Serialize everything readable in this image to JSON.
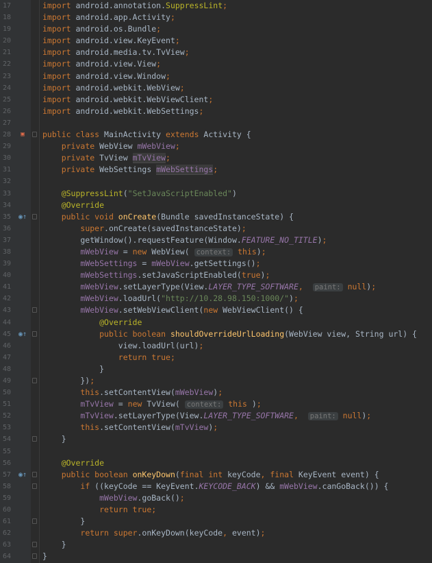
{
  "editor": {
    "lines": [
      {
        "n": "17",
        "t": [
          {
            "c": "k",
            "v": "import "
          },
          {
            "c": "p",
            "v": "android.annotation."
          },
          {
            "c": "a",
            "v": "SuppressLint"
          },
          {
            "c": "k",
            "v": ";"
          }
        ]
      },
      {
        "n": "18",
        "t": [
          {
            "c": "k",
            "v": "import "
          },
          {
            "c": "p",
            "v": "android.app.Activity"
          },
          {
            "c": "k",
            "v": ";"
          }
        ]
      },
      {
        "n": "19",
        "t": [
          {
            "c": "k",
            "v": "import "
          },
          {
            "c": "p",
            "v": "android.os.Bundle"
          },
          {
            "c": "k",
            "v": ";"
          }
        ]
      },
      {
        "n": "20",
        "t": [
          {
            "c": "k",
            "v": "import "
          },
          {
            "c": "p",
            "v": "android.view.KeyEvent"
          },
          {
            "c": "k",
            "v": ";"
          }
        ]
      },
      {
        "n": "21",
        "t": [
          {
            "c": "k",
            "v": "import "
          },
          {
            "c": "p",
            "v": "android.media.tv.TvView"
          },
          {
            "c": "k",
            "v": ";"
          }
        ]
      },
      {
        "n": "22",
        "t": [
          {
            "c": "k",
            "v": "import "
          },
          {
            "c": "p",
            "v": "android.view.View"
          },
          {
            "c": "k",
            "v": ";"
          }
        ]
      },
      {
        "n": "23",
        "t": [
          {
            "c": "k",
            "v": "import "
          },
          {
            "c": "p",
            "v": "android.view.Window"
          },
          {
            "c": "k",
            "v": ";"
          }
        ]
      },
      {
        "n": "24",
        "t": [
          {
            "c": "k",
            "v": "import "
          },
          {
            "c": "p",
            "v": "android.webkit.WebView"
          },
          {
            "c": "k",
            "v": ";"
          }
        ]
      },
      {
        "n": "25",
        "t": [
          {
            "c": "k",
            "v": "import "
          },
          {
            "c": "p",
            "v": "android.webkit.WebViewClient"
          },
          {
            "c": "k",
            "v": ";"
          }
        ]
      },
      {
        "n": "26",
        "t": [
          {
            "c": "k",
            "v": "import "
          },
          {
            "c": "p",
            "v": "android.webkit.WebSettings"
          },
          {
            "c": "k",
            "v": ";"
          }
        ]
      },
      {
        "n": "27",
        "t": []
      },
      {
        "n": "28",
        "icon": "git",
        "t": [
          {
            "c": "k",
            "v": "public class "
          },
          {
            "c": "p",
            "v": "MainActivity "
          },
          {
            "c": "k",
            "v": "extends "
          },
          {
            "c": "p",
            "v": "Activity {"
          }
        ]
      },
      {
        "n": "29",
        "t": [
          {
            "c": "p",
            "v": "    "
          },
          {
            "c": "k",
            "v": "private "
          },
          {
            "c": "p",
            "v": "WebView "
          },
          {
            "c": "f",
            "v": "mWebView"
          },
          {
            "c": "k",
            "v": ";"
          }
        ]
      },
      {
        "n": "30",
        "t": [
          {
            "c": "p",
            "v": "    "
          },
          {
            "c": "k",
            "v": "private "
          },
          {
            "c": "p",
            "v": "TvView "
          },
          {
            "c": "fh",
            "v": "mTvView"
          },
          {
            "c": "k",
            "v": ";"
          }
        ]
      },
      {
        "n": "31",
        "t": [
          {
            "c": "p",
            "v": "    "
          },
          {
            "c": "k",
            "v": "private "
          },
          {
            "c": "p",
            "v": "WebSettings "
          },
          {
            "c": "fh",
            "v": "mWebSettings"
          },
          {
            "c": "k",
            "v": ";"
          }
        ]
      },
      {
        "n": "32",
        "t": []
      },
      {
        "n": "33",
        "t": [
          {
            "c": "p",
            "v": "    "
          },
          {
            "c": "a",
            "v": "@SuppressLint"
          },
          {
            "c": "p",
            "v": "("
          },
          {
            "c": "s",
            "v": "\"SetJavaScriptEnabled\""
          },
          {
            "c": "p",
            "v": ")"
          }
        ]
      },
      {
        "n": "34",
        "t": [
          {
            "c": "p",
            "v": "    "
          },
          {
            "c": "a",
            "v": "@Override"
          }
        ]
      },
      {
        "n": "35",
        "icon": "over",
        "t": [
          {
            "c": "p",
            "v": "    "
          },
          {
            "c": "k",
            "v": "public void "
          },
          {
            "c": "m",
            "v": "onCreate"
          },
          {
            "c": "p",
            "v": "(Bundle savedInstanceState) {"
          }
        ]
      },
      {
        "n": "36",
        "t": [
          {
            "c": "p",
            "v": "        "
          },
          {
            "c": "k",
            "v": "super"
          },
          {
            "c": "p",
            "v": ".onCreate(savedInstanceState)"
          },
          {
            "c": "k",
            "v": ";"
          }
        ]
      },
      {
        "n": "37",
        "t": [
          {
            "c": "p",
            "v": "        getWindow().requestFeature(Window."
          },
          {
            "c": "fi",
            "v": "FEATURE_NO_TITLE"
          },
          {
            "c": "p",
            "v": ")"
          },
          {
            "c": "k",
            "v": ";"
          }
        ]
      },
      {
        "n": "38",
        "t": [
          {
            "c": "p",
            "v": "        "
          },
          {
            "c": "f",
            "v": "mWebView"
          },
          {
            "c": "p",
            "v": " = "
          },
          {
            "c": "k",
            "v": "new "
          },
          {
            "c": "p",
            "v": "WebView( "
          },
          {
            "c": "h",
            "v": "context:"
          },
          {
            "c": "p",
            "v": " "
          },
          {
            "c": "k",
            "v": "this"
          },
          {
            "c": "p",
            "v": ")"
          },
          {
            "c": "k",
            "v": ";"
          }
        ]
      },
      {
        "n": "39",
        "t": [
          {
            "c": "p",
            "v": "        "
          },
          {
            "c": "f",
            "v": "mWebSettings"
          },
          {
            "c": "p",
            "v": " = "
          },
          {
            "c": "f",
            "v": "mWebView"
          },
          {
            "c": "p",
            "v": ".getSettings()"
          },
          {
            "c": "k",
            "v": ";"
          }
        ]
      },
      {
        "n": "40",
        "t": [
          {
            "c": "p",
            "v": "        "
          },
          {
            "c": "f",
            "v": "mWebSettings"
          },
          {
            "c": "p",
            "v": ".setJavaScriptEnabled("
          },
          {
            "c": "k",
            "v": "true"
          },
          {
            "c": "p",
            "v": ")"
          },
          {
            "c": "k",
            "v": ";"
          }
        ]
      },
      {
        "n": "41",
        "t": [
          {
            "c": "p",
            "v": "        "
          },
          {
            "c": "f",
            "v": "mWebView"
          },
          {
            "c": "p",
            "v": ".setLayerType(View."
          },
          {
            "c": "fi",
            "v": "LAYER_TYPE_SOFTWARE"
          },
          {
            "c": "k",
            "v": ","
          },
          {
            "c": "p",
            "v": "  "
          },
          {
            "c": "h",
            "v": "paint:"
          },
          {
            "c": "p",
            "v": " "
          },
          {
            "c": "k",
            "v": "null"
          },
          {
            "c": "p",
            "v": ")"
          },
          {
            "c": "k",
            "v": ";"
          }
        ]
      },
      {
        "n": "42",
        "t": [
          {
            "c": "p",
            "v": "        "
          },
          {
            "c": "f",
            "v": "mWebView"
          },
          {
            "c": "p",
            "v": ".loadUrl("
          },
          {
            "c": "s",
            "v": "\"http://10.28.98.150:1000/\""
          },
          {
            "c": "p",
            "v": ")"
          },
          {
            "c": "k",
            "v": ";"
          }
        ]
      },
      {
        "n": "43",
        "t": [
          {
            "c": "p",
            "v": "        "
          },
          {
            "c": "f",
            "v": "mWebView"
          },
          {
            "c": "p",
            "v": ".setWebViewClient("
          },
          {
            "c": "k",
            "v": "new "
          },
          {
            "c": "p",
            "v": "WebViewClient() {"
          }
        ]
      },
      {
        "n": "44",
        "t": [
          {
            "c": "p",
            "v": "            "
          },
          {
            "c": "a",
            "v": "@Override"
          }
        ]
      },
      {
        "n": "45",
        "icon": "over",
        "t": [
          {
            "c": "p",
            "v": "            "
          },
          {
            "c": "k",
            "v": "public boolean "
          },
          {
            "c": "m",
            "v": "shouldOverrideUrlLoading"
          },
          {
            "c": "p",
            "v": "(WebView view, String url) {"
          }
        ]
      },
      {
        "n": "46",
        "t": [
          {
            "c": "p",
            "v": "                view.loadUrl(url)"
          },
          {
            "c": "k",
            "v": ";"
          }
        ]
      },
      {
        "n": "47",
        "t": [
          {
            "c": "p",
            "v": "                "
          },
          {
            "c": "k",
            "v": "return true;"
          }
        ]
      },
      {
        "n": "48",
        "t": [
          {
            "c": "p",
            "v": "            }"
          }
        ]
      },
      {
        "n": "49",
        "t": [
          {
            "c": "p",
            "v": "        })"
          },
          {
            "c": "k",
            "v": ";"
          }
        ]
      },
      {
        "n": "50",
        "t": [
          {
            "c": "p",
            "v": "        "
          },
          {
            "c": "k",
            "v": "this"
          },
          {
            "c": "p",
            "v": ".setContentView("
          },
          {
            "c": "f",
            "v": "mWebView"
          },
          {
            "c": "p",
            "v": ")"
          },
          {
            "c": "k",
            "v": ";"
          }
        ]
      },
      {
        "n": "51",
        "t": [
          {
            "c": "p",
            "v": "        "
          },
          {
            "c": "f",
            "v": "mTvView"
          },
          {
            "c": "p",
            "v": " = "
          },
          {
            "c": "k",
            "v": "new "
          },
          {
            "c": "p",
            "v": "TvView( "
          },
          {
            "c": "h",
            "v": "context:"
          },
          {
            "c": "p",
            "v": " "
          },
          {
            "c": "k",
            "v": "this"
          },
          {
            "c": "p",
            "v": " )"
          },
          {
            "c": "k",
            "v": ";"
          }
        ]
      },
      {
        "n": "52",
        "t": [
          {
            "c": "p",
            "v": "        "
          },
          {
            "c": "f",
            "v": "mTvView"
          },
          {
            "c": "p",
            "v": ".setLayerType(View."
          },
          {
            "c": "fi",
            "v": "LAYER_TYPE_SOFTWARE"
          },
          {
            "c": "k",
            "v": ","
          },
          {
            "c": "p",
            "v": "  "
          },
          {
            "c": "h",
            "v": "paint:"
          },
          {
            "c": "p",
            "v": " "
          },
          {
            "c": "k",
            "v": "null"
          },
          {
            "c": "p",
            "v": ")"
          },
          {
            "c": "k",
            "v": ";"
          }
        ]
      },
      {
        "n": "53",
        "t": [
          {
            "c": "p",
            "v": "        "
          },
          {
            "c": "k",
            "v": "this"
          },
          {
            "c": "p",
            "v": ".setContentView("
          },
          {
            "c": "f",
            "v": "mTvView"
          },
          {
            "c": "p",
            "v": ")"
          },
          {
            "c": "k",
            "v": ";"
          }
        ]
      },
      {
        "n": "54",
        "t": [
          {
            "c": "p",
            "v": "    }"
          }
        ]
      },
      {
        "n": "55",
        "t": []
      },
      {
        "n": "56",
        "t": [
          {
            "c": "p",
            "v": "    "
          },
          {
            "c": "a",
            "v": "@Override"
          }
        ]
      },
      {
        "n": "57",
        "icon": "over",
        "t": [
          {
            "c": "p",
            "v": "    "
          },
          {
            "c": "k",
            "v": "public boolean "
          },
          {
            "c": "m",
            "v": "onKeyDown"
          },
          {
            "c": "p",
            "v": "("
          },
          {
            "c": "k",
            "v": "final int "
          },
          {
            "c": "p",
            "v": "keyCode"
          },
          {
            "c": "k",
            "v": ", final "
          },
          {
            "c": "p",
            "v": "KeyEvent event) {"
          }
        ]
      },
      {
        "n": "58",
        "t": [
          {
            "c": "p",
            "v": "        "
          },
          {
            "c": "k",
            "v": "if "
          },
          {
            "c": "p",
            "v": "((keyCode == KeyEvent."
          },
          {
            "c": "fi",
            "v": "KEYCODE_BACK"
          },
          {
            "c": "p",
            "v": ") && "
          },
          {
            "c": "f",
            "v": "mWebView"
          },
          {
            "c": "p",
            "v": ".canGoBack()) {"
          }
        ]
      },
      {
        "n": "59",
        "t": [
          {
            "c": "p",
            "v": "            "
          },
          {
            "c": "f",
            "v": "mWebView"
          },
          {
            "c": "p",
            "v": ".goBack()"
          },
          {
            "c": "k",
            "v": ";"
          }
        ]
      },
      {
        "n": "60",
        "t": [
          {
            "c": "p",
            "v": "            "
          },
          {
            "c": "k",
            "v": "return true;"
          }
        ]
      },
      {
        "n": "61",
        "t": [
          {
            "c": "p",
            "v": "        }"
          }
        ]
      },
      {
        "n": "62",
        "t": [
          {
            "c": "p",
            "v": "        "
          },
          {
            "c": "k",
            "v": "return super"
          },
          {
            "c": "p",
            "v": ".onKeyDown(keyCode"
          },
          {
            "c": "k",
            "v": ", "
          },
          {
            "c": "p",
            "v": "event)"
          },
          {
            "c": "k",
            "v": ";"
          }
        ]
      },
      {
        "n": "63",
        "t": [
          {
            "c": "p",
            "v": "    }"
          }
        ]
      },
      {
        "n": "64",
        "t": [
          {
            "c": "p",
            "v": "}"
          }
        ]
      }
    ]
  },
  "icons": {
    "override": "override-method-icon",
    "git": "android-activity-icon"
  },
  "colors": {
    "background": "#2b2b2b",
    "gutter": "#313335",
    "keyword": "#cc7832",
    "annotation": "#bbb529",
    "string": "#6a8759",
    "field": "#9876aa",
    "method": "#ffc66d",
    "plain": "#a9b7c6",
    "line_number": "#606366"
  }
}
